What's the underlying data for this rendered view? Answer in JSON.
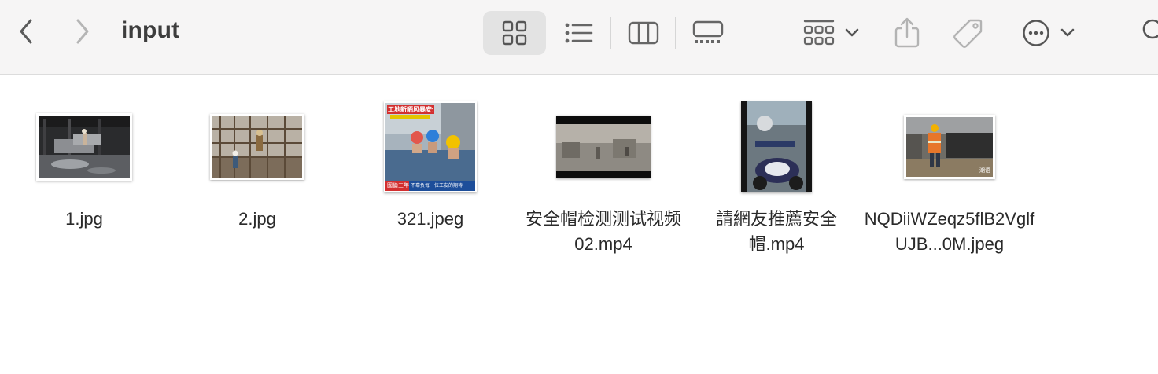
{
  "window": {
    "title": "input"
  },
  "toolbar": {
    "back_icon": "chevron-left-icon",
    "forward_icon": "chevron-right-icon",
    "view_modes": [
      "icon-view",
      "list-view",
      "column-view",
      "gallery-view"
    ],
    "active_view": "icon-view",
    "group_icon": "group-by-icon",
    "share_icon": "share-icon",
    "tag_icon": "tag-icon",
    "more_icon": "more-actions-icon",
    "search_icon": "search-icon"
  },
  "files": [
    {
      "name": "1.jpg",
      "kind": "image"
    },
    {
      "name": "2.jpg",
      "kind": "image"
    },
    {
      "name": "321.jpeg",
      "kind": "image",
      "thumb_text_top": "工地新晒风暴安全帽",
      "thumb_text_bottom_left": "國倫三年",
      "thumb_text_bottom_right": "不辜负每一位工友的期待"
    },
    {
      "name": "安全帽检测测试视频02.mp4",
      "kind": "video"
    },
    {
      "name": "請網友推薦安全帽.mp4",
      "kind": "video"
    },
    {
      "name": "NQDiiWZeqz5flB2VglfUJB...0M.jpeg",
      "kind": "image",
      "thumb_text_corner": "潮语"
    }
  ],
  "colors": {
    "toolbar_bg": "#f6f5f5",
    "selected_view_bg": "#e3e3e3",
    "icon_gray": "#6e6e6e",
    "icon_disabled": "#b3b3b3"
  }
}
